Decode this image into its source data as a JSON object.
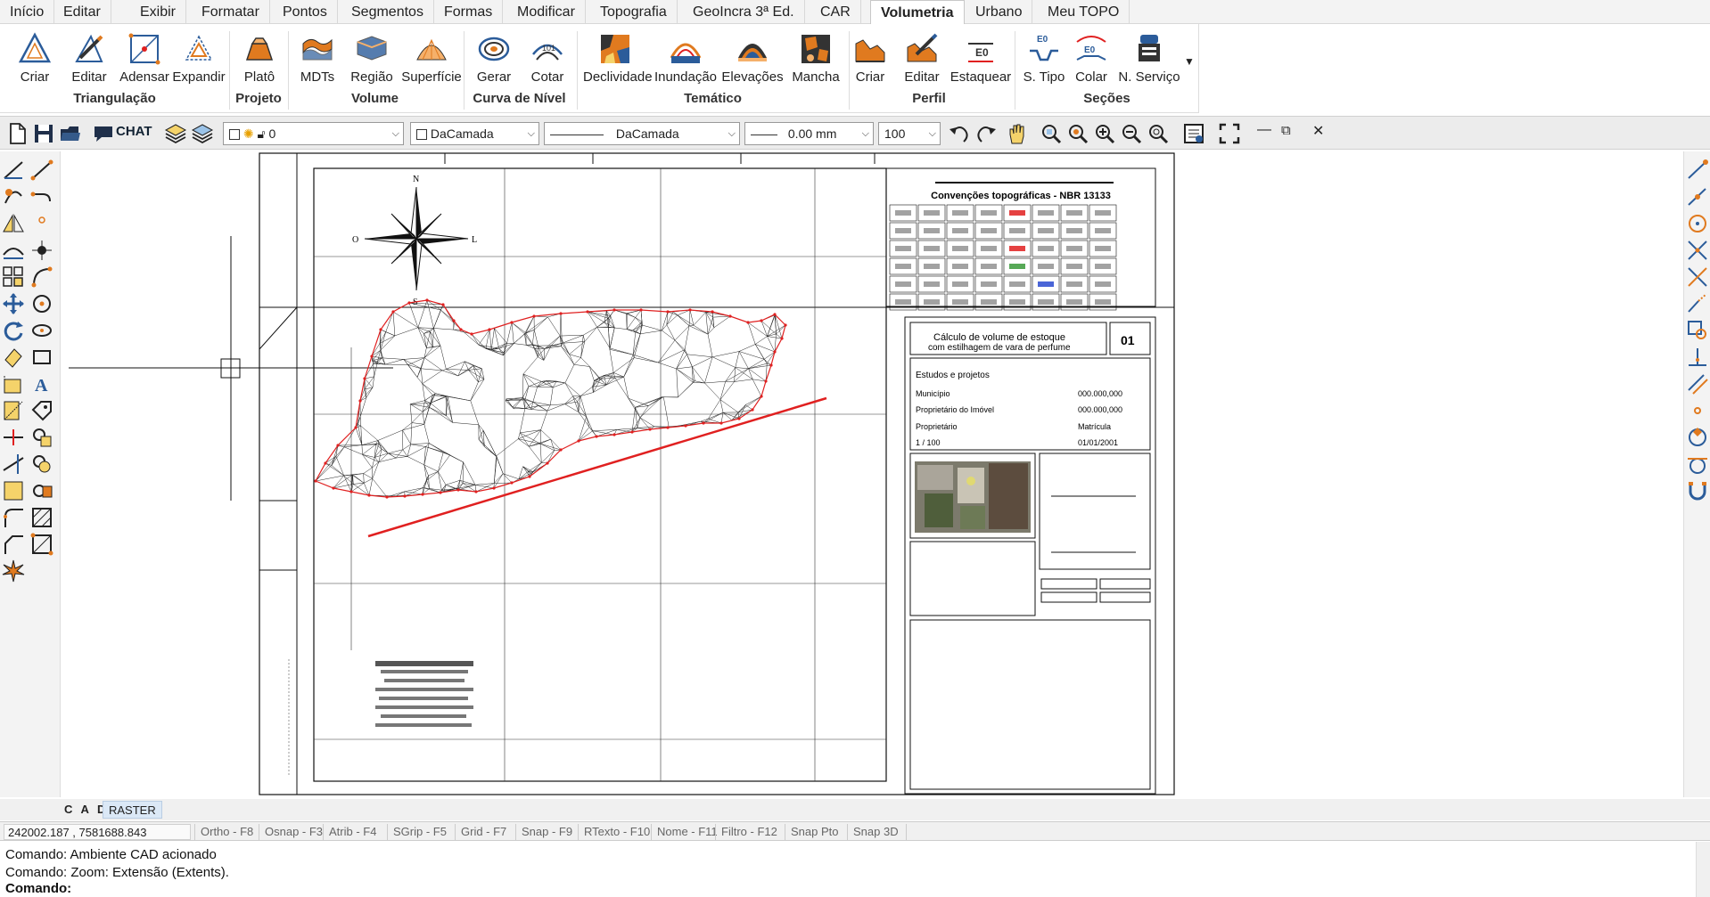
{
  "menu": {
    "tabs": [
      "Início",
      "Editar",
      "Exibir",
      "Formatar",
      "Pontos",
      "Segmentos",
      "Formas",
      "Modificar",
      "Topografia",
      "GeoIncra 3ª Ed.",
      "CAR",
      "Volumetria",
      "Urbano",
      "Meu TOPO"
    ],
    "active": "Volumetria"
  },
  "ribbon": {
    "buttons": {
      "criar": "Criar",
      "editar": "Editar",
      "adensar": "Adensar",
      "expandir": "Expandir",
      "plato": "Platô",
      "mdts": "MDTs",
      "regiao": "Região",
      "superficie": "Superfície",
      "gerar": "Gerar",
      "cotar": "Cotar",
      "declividade": "Declividade",
      "inundacao": "Inundação",
      "elevacoes": "Elevações",
      "mancha": "Mancha",
      "perfil_criar": "Criar",
      "perfil_editar": "Editar",
      "estaquear": "Estaquear",
      "s_tipo": "S. Tipo",
      "colar": "Colar",
      "n_servico": "N. Serviço"
    },
    "groups": {
      "triangulacao": "Triangulação",
      "projeto": "Projeto",
      "volume": "Volume",
      "curva": "Curva de Nível",
      "tematico": "Temático",
      "perfil": "Perfil",
      "secoes": "Seções"
    },
    "icon_text": {
      "e0": "E0",
      "num": "101"
    }
  },
  "toolbar": {
    "chat": "CHAT",
    "layer": "0",
    "color": "DaCamada",
    "linetype": "DaCamada",
    "lineweight": "0.00 mm",
    "scale": "100"
  },
  "drawing": {
    "legend_title": "Convenções topográficas - NBR 13133",
    "title_block": {
      "title_line1": "Cálculo de volume de estoque",
      "title_line2": "com estilhagem de vara de perfume",
      "sheet": "01",
      "client": "Estudos e projetos",
      "municipio_label": "Município",
      "area_value": "000.000,000",
      "property_label": "Proprietário do Imóvel",
      "perimeter_value": "000.000,000",
      "owner_label": "Proprietário",
      "matricula_label": "Matrícula",
      "scale_value": "1 / 100",
      "date_value": "01/01/2001"
    },
    "compass": {
      "n": "N",
      "s": "S",
      "e": "L",
      "w": "O"
    }
  },
  "modes": {
    "cad": "C A D",
    "raster": "RASTER"
  },
  "status": {
    "coords": "242002.187 , 7581688.843",
    "buttons": [
      "Ortho - F8",
      "Osnap - F3",
      "Atrib - F4",
      "SGrip - F5",
      "Grid - F7",
      "Snap - F9",
      "RTexto - F10",
      "Nome - F11",
      "Filtro - F12",
      "Snap Pto",
      "Snap 3D"
    ]
  },
  "command": {
    "lines": [
      "Comando: Ambiente CAD acionado",
      "Comando: Zoom: Extensão (Extents)."
    ],
    "prompt": "Comando:"
  },
  "colors": {
    "accent_red": "#e02020",
    "icon_blue": "#2b5c9a",
    "icon_orange": "#e07a1f"
  }
}
